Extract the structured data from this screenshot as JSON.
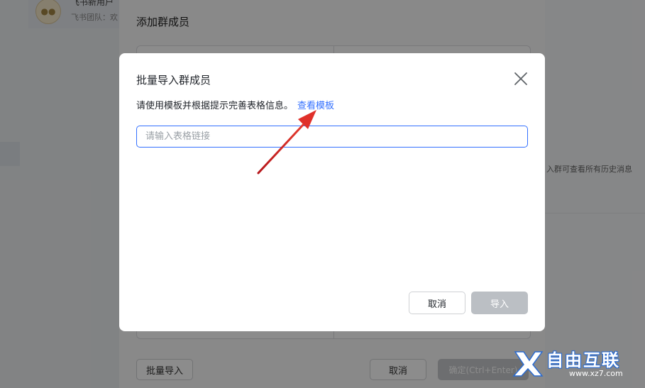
{
  "background": {
    "chat_title": "飞书新用户",
    "chat_subtitle": "飞书团队：欢",
    "right_text": "入群可查看所有历史消息"
  },
  "outer_dialog": {
    "title": "添加群成员",
    "batch_import_label": "批量导入",
    "cancel_label": "取消",
    "confirm_label": "确定(Ctrl+Enter)"
  },
  "modal": {
    "title": "批量导入群成员",
    "hint": "请使用模板并根据提示完善表格信息。",
    "template_link": "查看模板",
    "input_placeholder": "请输入表格链接",
    "cancel_label": "取消",
    "import_label": "导入"
  },
  "watermark": {
    "text": "自由互联",
    "url": "www.xz7.com"
  },
  "colors": {
    "accent": "#3370ff",
    "disabled_button": "#bbbfc4",
    "annotation_arrow": "#d62828"
  }
}
